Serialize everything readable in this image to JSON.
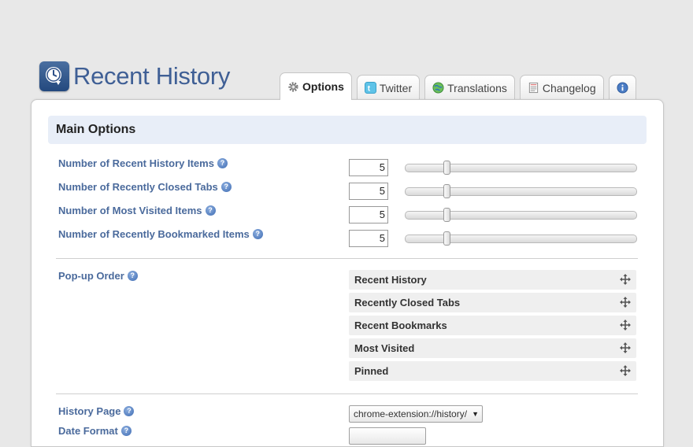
{
  "app": {
    "title": "Recent History"
  },
  "tabs": [
    {
      "label": "Options",
      "icon": "gear-icon",
      "active": true
    },
    {
      "label": "Twitter",
      "icon": "twitter-icon",
      "active": false
    },
    {
      "label": "Translations",
      "icon": "globe-icon",
      "active": false
    },
    {
      "label": "Changelog",
      "icon": "document-icon",
      "active": false
    },
    {
      "label": "",
      "icon": "info-icon",
      "active": false
    }
  ],
  "main": {
    "header": "Main Options",
    "counts": [
      {
        "label": "Number of Recent History Items",
        "value": "5",
        "slider_fraction": 0.18
      },
      {
        "label": "Number of Recently Closed Tabs",
        "value": "5",
        "slider_fraction": 0.18
      },
      {
        "label": "Number of Most Visited Items",
        "value": "5",
        "slider_fraction": 0.18
      },
      {
        "label": "Number of Recently Bookmarked Items",
        "value": "5",
        "slider_fraction": 0.18
      }
    ],
    "popup_order": {
      "label": "Pop-up Order",
      "items": [
        "Recent History",
        "Recently Closed Tabs",
        "Recent Bookmarks",
        "Most Visited",
        "Pinned"
      ]
    },
    "history_page": {
      "label": "History Page",
      "value": "chrome-extension://history/"
    },
    "date_format": {
      "label": "Date Format"
    }
  },
  "colors": {
    "label_blue": "#4a6a9c",
    "header_bg": "#e8eef8",
    "logo_blue": "#3f5f95"
  }
}
